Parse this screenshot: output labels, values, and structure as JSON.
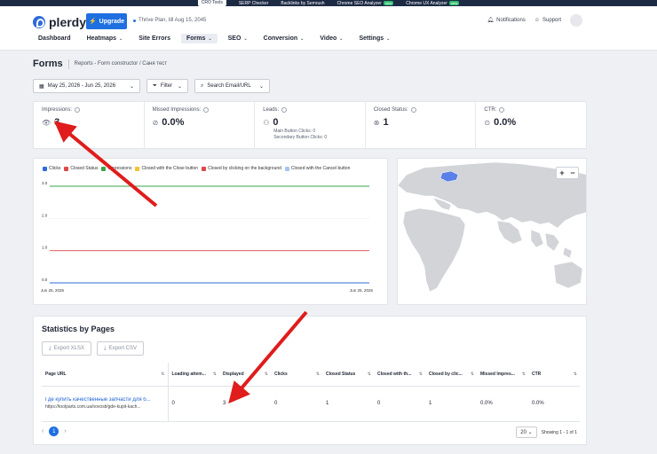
{
  "topbar": {
    "tools": [
      "CRO Tools",
      "SERP Checker",
      "Backlinks by Semrush",
      "Chrome SEO Analyzer",
      "Chrome UX Analyzer"
    ],
    "new_badge": "new"
  },
  "header": {
    "logo": "plerdy",
    "upgrade_label": "Upgrade",
    "plan_text": "Thrive Plan, till Aug 15, 2045",
    "notifications_label": "Notifications",
    "support_label": "Support"
  },
  "nav": {
    "items": [
      "Dashboard",
      "Heatmaps",
      "Site Errors",
      "Forms",
      "SEO",
      "Conversion",
      "Video",
      "Settings"
    ],
    "active": "Forms"
  },
  "page": {
    "title": "Forms",
    "breadcrumb": "Reports - Form constructor / Саня тест"
  },
  "filters": {
    "date_range": "May 25, 2026 - Jun 25, 2026",
    "filter_label": "Filter",
    "search_label": "Search Email/URL"
  },
  "metrics": [
    {
      "label": "Impressions:",
      "value": "3",
      "icon": "eye-icon"
    },
    {
      "label": "Missed Impressions:",
      "value": "0.0%",
      "icon": "eye-off-icon"
    },
    {
      "label": "Leads:",
      "value": "0",
      "icon": "user-plus-icon",
      "sub1": "Main Button Clicks: 0",
      "sub2": "Secondary Button Clicks: 0"
    },
    {
      "label": "Closed Status:",
      "value": "1",
      "icon": "close-circle-icon"
    },
    {
      "label": "CTR:",
      "value": "0.0%",
      "icon": "check-circle-icon"
    }
  ],
  "chart_data": {
    "type": "line",
    "legend": [
      {
        "name": "Clicks",
        "color": "#2e6bd9"
      },
      {
        "name": "Closed Status",
        "color": "#e04848"
      },
      {
        "name": "Impressions",
        "color": "#3aa64a"
      },
      {
        "name": "Closed with the Close button",
        "color": "#f2c230"
      },
      {
        "name": "Closed by clicking on the background",
        "color": "#e04848"
      },
      {
        "name": "Closed with the Cancel button",
        "color": "#a8c4f0"
      }
    ],
    "x": [
      "Jun 25, 2026",
      "Jun 25, 2026"
    ],
    "y_ticks": [
      "0.0",
      "1.0",
      "2.0",
      "3.0"
    ],
    "ylim": [
      0,
      3
    ],
    "series": [
      {
        "name": "Impressions",
        "values": [
          3,
          3
        ],
        "color": "#3aa64a"
      },
      {
        "name": "Closed Status",
        "values": [
          1,
          1
        ],
        "color": "#e04848"
      },
      {
        "name": "Clicks",
        "values": [
          0,
          0
        ],
        "color": "#2e6bd9"
      }
    ]
  },
  "stats": {
    "title": "Statistics by Pages",
    "export_xlsx": "Export XLSX",
    "export_csv": "Export CSV",
    "columns": [
      "Page URL",
      "Loading attem...",
      "Displayed",
      "Clicks",
      "Closed Status",
      "Closed with th...",
      "Closed by clic...",
      "Missed Impres...",
      "CTR"
    ],
    "rows": [
      {
        "title": "Где купить качественные запчасти для б...",
        "url": "https://toolparts.com.ua/novosti/gde-kupit-kach...",
        "cells": [
          "0",
          "3",
          "0",
          "1",
          "0",
          "1",
          "0.0%",
          "0.0%"
        ]
      }
    ],
    "page": "1",
    "page_size": "20",
    "showing": "Showing 1 - 1 of 1"
  }
}
